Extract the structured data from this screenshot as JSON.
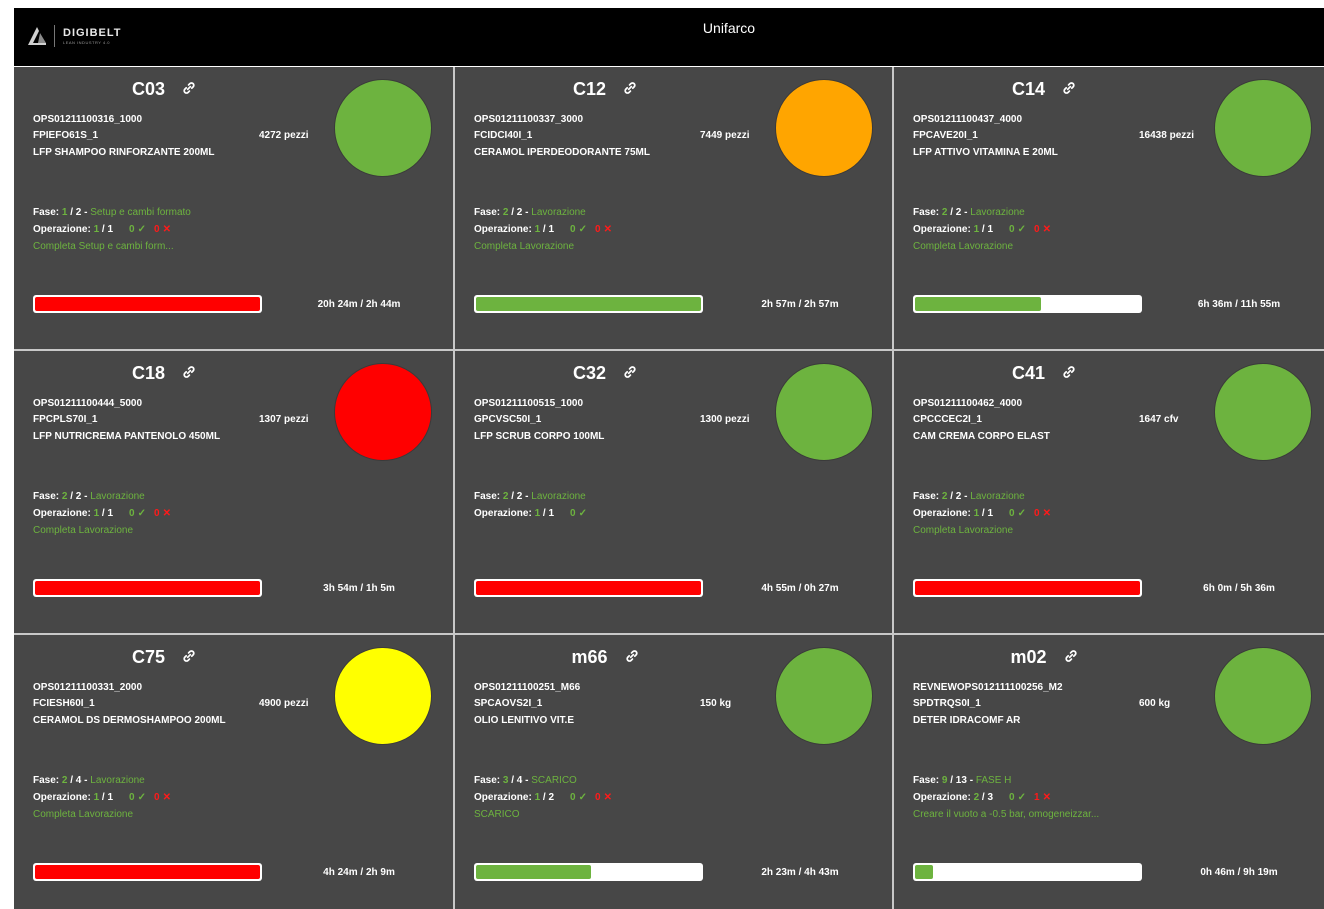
{
  "header": {
    "logo_name": "DIGIBELT",
    "logo_sub": "LEAN INDUSTRY 4.0",
    "company": "Unifarco"
  },
  "labels": {
    "phase": "Fase: ",
    "operation": "Operazione: "
  },
  "colors": {
    "green": "#6db33f",
    "orange": "#ffa500",
    "red": "#ff0000",
    "yellow": "#ffff00"
  },
  "cards": [
    {
      "machine": "C03",
      "order": "OPS01211100316_1000",
      "code": "FPIEFO61S_1",
      "qty": "4272 pezzi",
      "product": "LFP SHAMPOO RINFORZANTE 200ML",
      "light": "green",
      "phase_cur": "1",
      "phase_tot": " / 2 - ",
      "phase_name": "Setup e cambi formato",
      "op_cur": "1",
      "op_tot": " / 1",
      "ok": "0",
      "ko": "0",
      "action": "Completa Setup e cambi form...",
      "progress": 1.0,
      "bar": "red",
      "times": "20h 24m / 2h 44m"
    },
    {
      "machine": "C12",
      "order": "OPS01211100337_3000",
      "code": "FCIDCI40I_1",
      "qty": "7449 pezzi",
      "product": "CERAMOL IPERDEODORANTE 75ML",
      "light": "orange",
      "phase_cur": "2",
      "phase_tot": " / 2 - ",
      "phase_name": "Lavorazione",
      "op_cur": "1",
      "op_tot": " / 1",
      "ok": "0",
      "ko": "0",
      "action": "Completa Lavorazione",
      "progress": 1.0,
      "bar": "green",
      "times": "2h 57m / 2h 57m"
    },
    {
      "machine": "C14",
      "order": "OPS01211100437_4000",
      "code": "FPCAVE20I_1",
      "qty": "16438 pezzi",
      "product": "LFP ATTIVO VITAMINA E 20ML",
      "light": "green",
      "phase_cur": "2",
      "phase_tot": " / 2 - ",
      "phase_name": "Lavorazione",
      "op_cur": "1",
      "op_tot": " / 1",
      "ok": "0",
      "ko": "0",
      "action": "Completa Lavorazione",
      "progress": 0.56,
      "bar": "green",
      "times": "6h 36m / 11h 55m"
    },
    {
      "machine": "C18",
      "order": "OPS01211100444_5000",
      "code": "FPCPLS70I_1",
      "qty": "1307 pezzi",
      "product": "LFP NUTRICREMA PANTENOLO 450ML",
      "light": "red",
      "phase_cur": "2",
      "phase_tot": " / 2 - ",
      "phase_name": "Lavorazione",
      "op_cur": "1",
      "op_tot": " / 1",
      "ok": "0",
      "ko": "0",
      "action": "Completa Lavorazione",
      "progress": 1.0,
      "bar": "red",
      "times": "3h 54m / 1h 5m"
    },
    {
      "machine": "C32",
      "order": "OPS01211100515_1000",
      "code": "GPCVSC50I_1",
      "qty": "1300 pezzi",
      "product": "LFP SCRUB CORPO 100ML",
      "light": "green",
      "phase_cur": "2",
      "phase_tot": " / 2 - ",
      "phase_name": "Lavorazione",
      "op_cur": "1",
      "op_tot": " / 1",
      "ok": "0",
      "ko": "",
      "action": "",
      "progress": 1.0,
      "bar": "red",
      "times": "4h 55m / 0h 27m"
    },
    {
      "machine": "C41",
      "order": "OPS01211100462_4000",
      "code": "CPCCCEC2I_1",
      "qty": "1647 cfv",
      "product": "CAM CREMA CORPO ELAST",
      "light": "green",
      "phase_cur": "2",
      "phase_tot": " / 2 - ",
      "phase_name": "Lavorazione",
      "op_cur": "1",
      "op_tot": " / 1",
      "ok": "0",
      "ko": "0",
      "action": "Completa Lavorazione",
      "progress": 1.0,
      "bar": "red",
      "times": "6h 0m / 5h 36m"
    },
    {
      "machine": "C75",
      "order": "OPS01211100331_2000",
      "code": "FCIESH60I_1",
      "qty": "4900 pezzi",
      "product": "CERAMOL DS DERMOSHAMPOO 200ML",
      "light": "yellow",
      "phase_cur": "2",
      "phase_tot": " / 4 - ",
      "phase_name": "Lavorazione",
      "op_cur": "1",
      "op_tot": " / 1",
      "ok": "0",
      "ko": "0",
      "action": "Completa Lavorazione",
      "progress": 1.0,
      "bar": "red",
      "times": "4h 24m / 2h 9m"
    },
    {
      "machine": "m66",
      "order": "OPS01211100251_M66",
      "code": "SPCAOVS2I_1",
      "qty": "150 kg",
      "product": "OLIO LENITIVO VIT.E",
      "light": "green",
      "phase_cur": "3",
      "phase_tot": " / 4 - ",
      "phase_name": "SCARICO",
      "op_cur": "1",
      "op_tot": " / 2",
      "ok": "0",
      "ko": "0",
      "action": "SCARICO",
      "progress": 0.51,
      "bar": "green",
      "times": "2h 23m / 4h 43m"
    },
    {
      "machine": "m02",
      "order": "REVNEWOPS012111100256_M2",
      "code": "SPDTRQS0I_1",
      "qty": "600 kg",
      "product": "DETER IDRACOMF AR",
      "light": "green",
      "phase_cur": "9",
      "phase_tot": " / 13 - ",
      "phase_name": "FASE H",
      "op_cur": "2",
      "op_tot": " / 3",
      "ok": "0",
      "ko": "1",
      "action": "Creare il vuoto a -0.5 bar, omogeneizzar...",
      "progress": 0.08,
      "bar": "green",
      "times": "0h 46m / 9h 19m"
    }
  ]
}
